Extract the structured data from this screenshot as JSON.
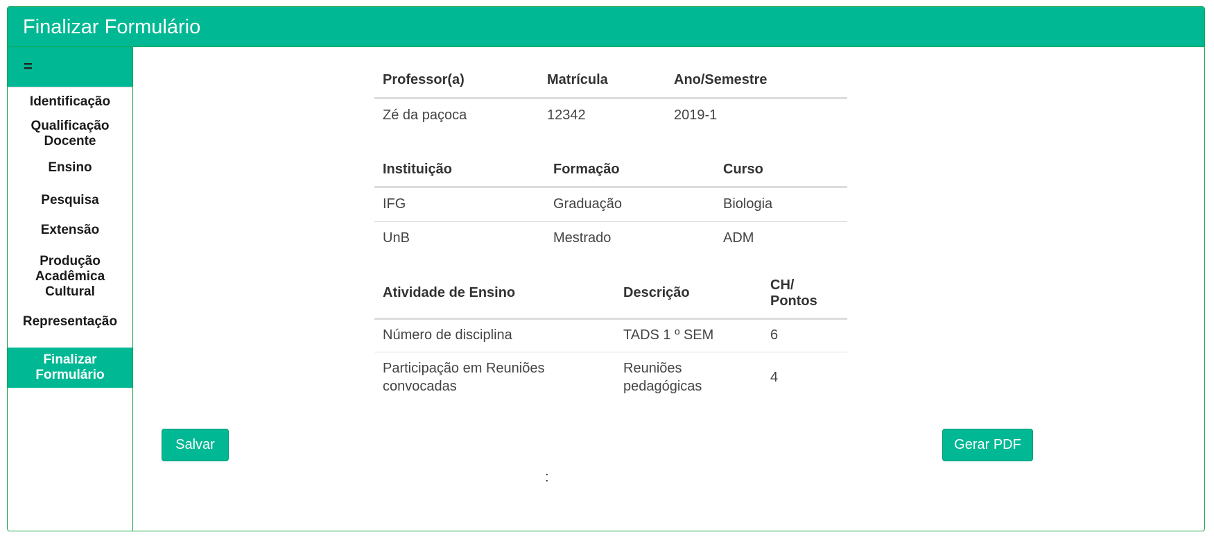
{
  "header": {
    "title": "Finalizar Formulário"
  },
  "sidebar": {
    "toggle_label": "=",
    "items": [
      {
        "label": "Identificação"
      },
      {
        "label": "Qualificação Docente"
      },
      {
        "label": "Ensino"
      },
      {
        "label": "Pesquisa"
      },
      {
        "label": "Extensão"
      },
      {
        "label": "Produção Acadêmica Cultural"
      },
      {
        "label": "Representação"
      },
      {
        "label": "Finalizar Formulário"
      }
    ]
  },
  "professor_table": {
    "headers": [
      "Professor(a)",
      "Matrícula",
      "Ano/Semestre"
    ],
    "rows": [
      [
        "Zé da paçoca",
        "12342",
        "2019-1"
      ]
    ]
  },
  "formacao_table": {
    "headers": [
      "Instituição",
      "Formação",
      "Curso"
    ],
    "rows": [
      [
        "IFG",
        "Graduação",
        "Biologia"
      ],
      [
        "UnB",
        "Mestrado",
        "ADM"
      ]
    ]
  },
  "ensino_table": {
    "headers": [
      "Atividade de Ensino",
      "Descrição",
      "CH/ Pontos"
    ],
    "rows": [
      [
        "Número de disciplina",
        "TADS 1 º SEM",
        "6"
      ],
      [
        "Participação em Reuniões convocadas",
        "Reuniões pedagógicas",
        "4"
      ]
    ]
  },
  "ellipsis": ":",
  "buttons": {
    "save_label": "Salvar",
    "pdf_label": "Gerar PDF"
  }
}
